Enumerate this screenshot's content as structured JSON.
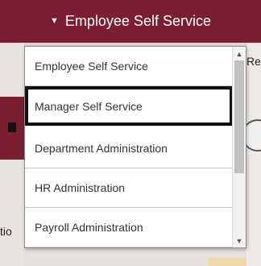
{
  "header": {
    "title": "Employee Self Service",
    "caret_icon": "caret-down-icon",
    "color": "#7a1e30"
  },
  "background": {
    "right_fragment": "Re",
    "left_fragment": "tio"
  },
  "dropdown": {
    "items": [
      {
        "label": "Employee Self Service",
        "highlighted": false
      },
      {
        "label": "Manager Self Service",
        "highlighted": true
      },
      {
        "label": "Department Administration",
        "highlighted": false
      },
      {
        "label": "HR Administration",
        "highlighted": false
      },
      {
        "label": "Payroll Administration",
        "highlighted": false
      }
    ],
    "scroll_up_icon": "chevron-up-icon",
    "scroll_down_icon": "chevron-down-icon"
  }
}
